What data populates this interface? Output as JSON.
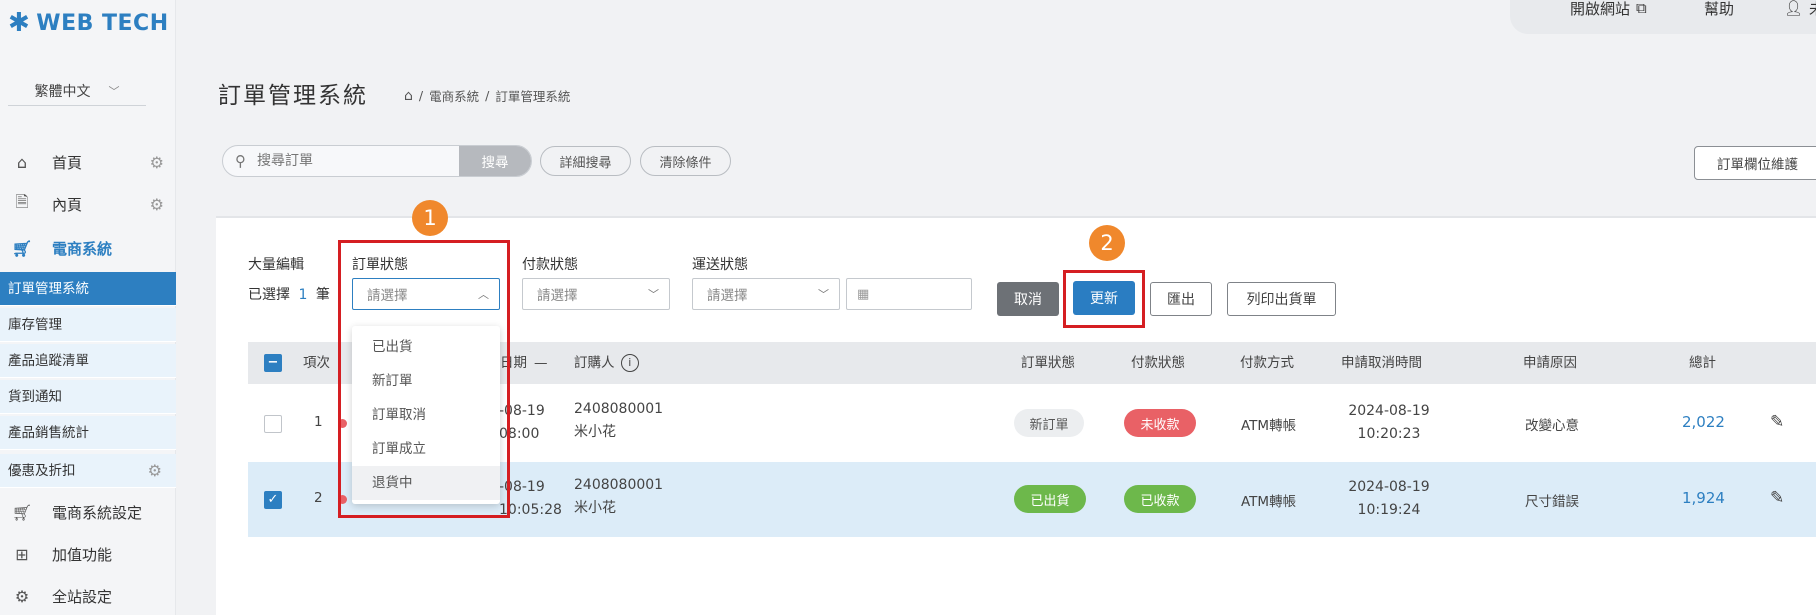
{
  "brand": {
    "logo_text": "WEB TECH",
    "accent": "#2d7fc1"
  },
  "sidebar": {
    "language": "繁體中文",
    "top_items": [
      {
        "label": "首頁",
        "icon": "home-icon"
      },
      {
        "label": "內頁",
        "icon": "document-icon"
      },
      {
        "label": "電商系統",
        "icon": "cart-icon"
      }
    ],
    "sub_items": [
      "訂單管理系統",
      "庫存管理",
      "產品追蹤清單",
      "貨到通知",
      "產品銷售統計",
      "優惠及折扣"
    ],
    "bottom_items": [
      {
        "label": "電商系統設定",
        "icon": "cart-icon"
      },
      {
        "label": "加值功能",
        "icon": "gift-icon"
      },
      {
        "label": "全站設定",
        "icon": "gear-icon"
      }
    ]
  },
  "header": {
    "open_site": "開啟網站",
    "help": "幫助",
    "user_label": "未"
  },
  "page": {
    "title": "訂單管理系統",
    "breadcrumb": [
      "電商系統",
      "訂單管理系統"
    ],
    "breadcrumb_sep": "/"
  },
  "search": {
    "placeholder": "搜尋訂單",
    "search_button": "搜尋",
    "advanced_button": "詳細搜尋",
    "clear_button": "清除條件",
    "maintain_button": "訂單欄位維護"
  },
  "bulk": {
    "title": "大量編輯",
    "selected_prefix": "已選擇",
    "selected_count": "1",
    "selected_suffix": "筆"
  },
  "filters": {
    "order_status_label": "訂單狀態",
    "payment_status_label": "付款狀態",
    "shipping_status_label": "運送狀態",
    "placeholder": "請選擇"
  },
  "dropdown": {
    "options": [
      "已出貨",
      "新訂單",
      "訂單取消",
      "訂單成立",
      "退貨中"
    ]
  },
  "actions": {
    "cancel": "取消",
    "update": "更新",
    "export": "匯出",
    "print": "列印出貨單"
  },
  "table": {
    "headers": {
      "index": "項次",
      "date": "日期",
      "date_sort": "—",
      "buyer": "訂購人",
      "order_status": "訂單狀態",
      "payment_status": "付款狀態",
      "payment_method": "付款方式",
      "cancel_time": "申請取消時間",
      "reason": "申請原因",
      "total": "總計"
    },
    "rows": [
      {
        "index": "1",
        "date_line1": "-08-19",
        "date_line2": "08:00",
        "order_no": "2408080001",
        "buyer": "米小花",
        "order_status": "新訂單",
        "payment_status": "未收款",
        "payment_method": "ATM轉帳",
        "cancel_date": "2024-08-19",
        "cancel_time": "10:20:23",
        "reason": "改變心意",
        "total": "2,022",
        "selected": false
      },
      {
        "index": "2",
        "date_line1": "-08-19",
        "date_line2": "10:05:28",
        "order_no": "2408080001",
        "buyer": "米小花",
        "order_status": "已出貨",
        "payment_status": "已收款",
        "payment_method": "ATM轉帳",
        "cancel_date": "2024-08-19",
        "cancel_time": "10:19:24",
        "reason": "尺寸錯誤",
        "total": "1,924",
        "selected": true
      }
    ]
  },
  "annotations": {
    "marker1": "1",
    "marker2": "2"
  }
}
